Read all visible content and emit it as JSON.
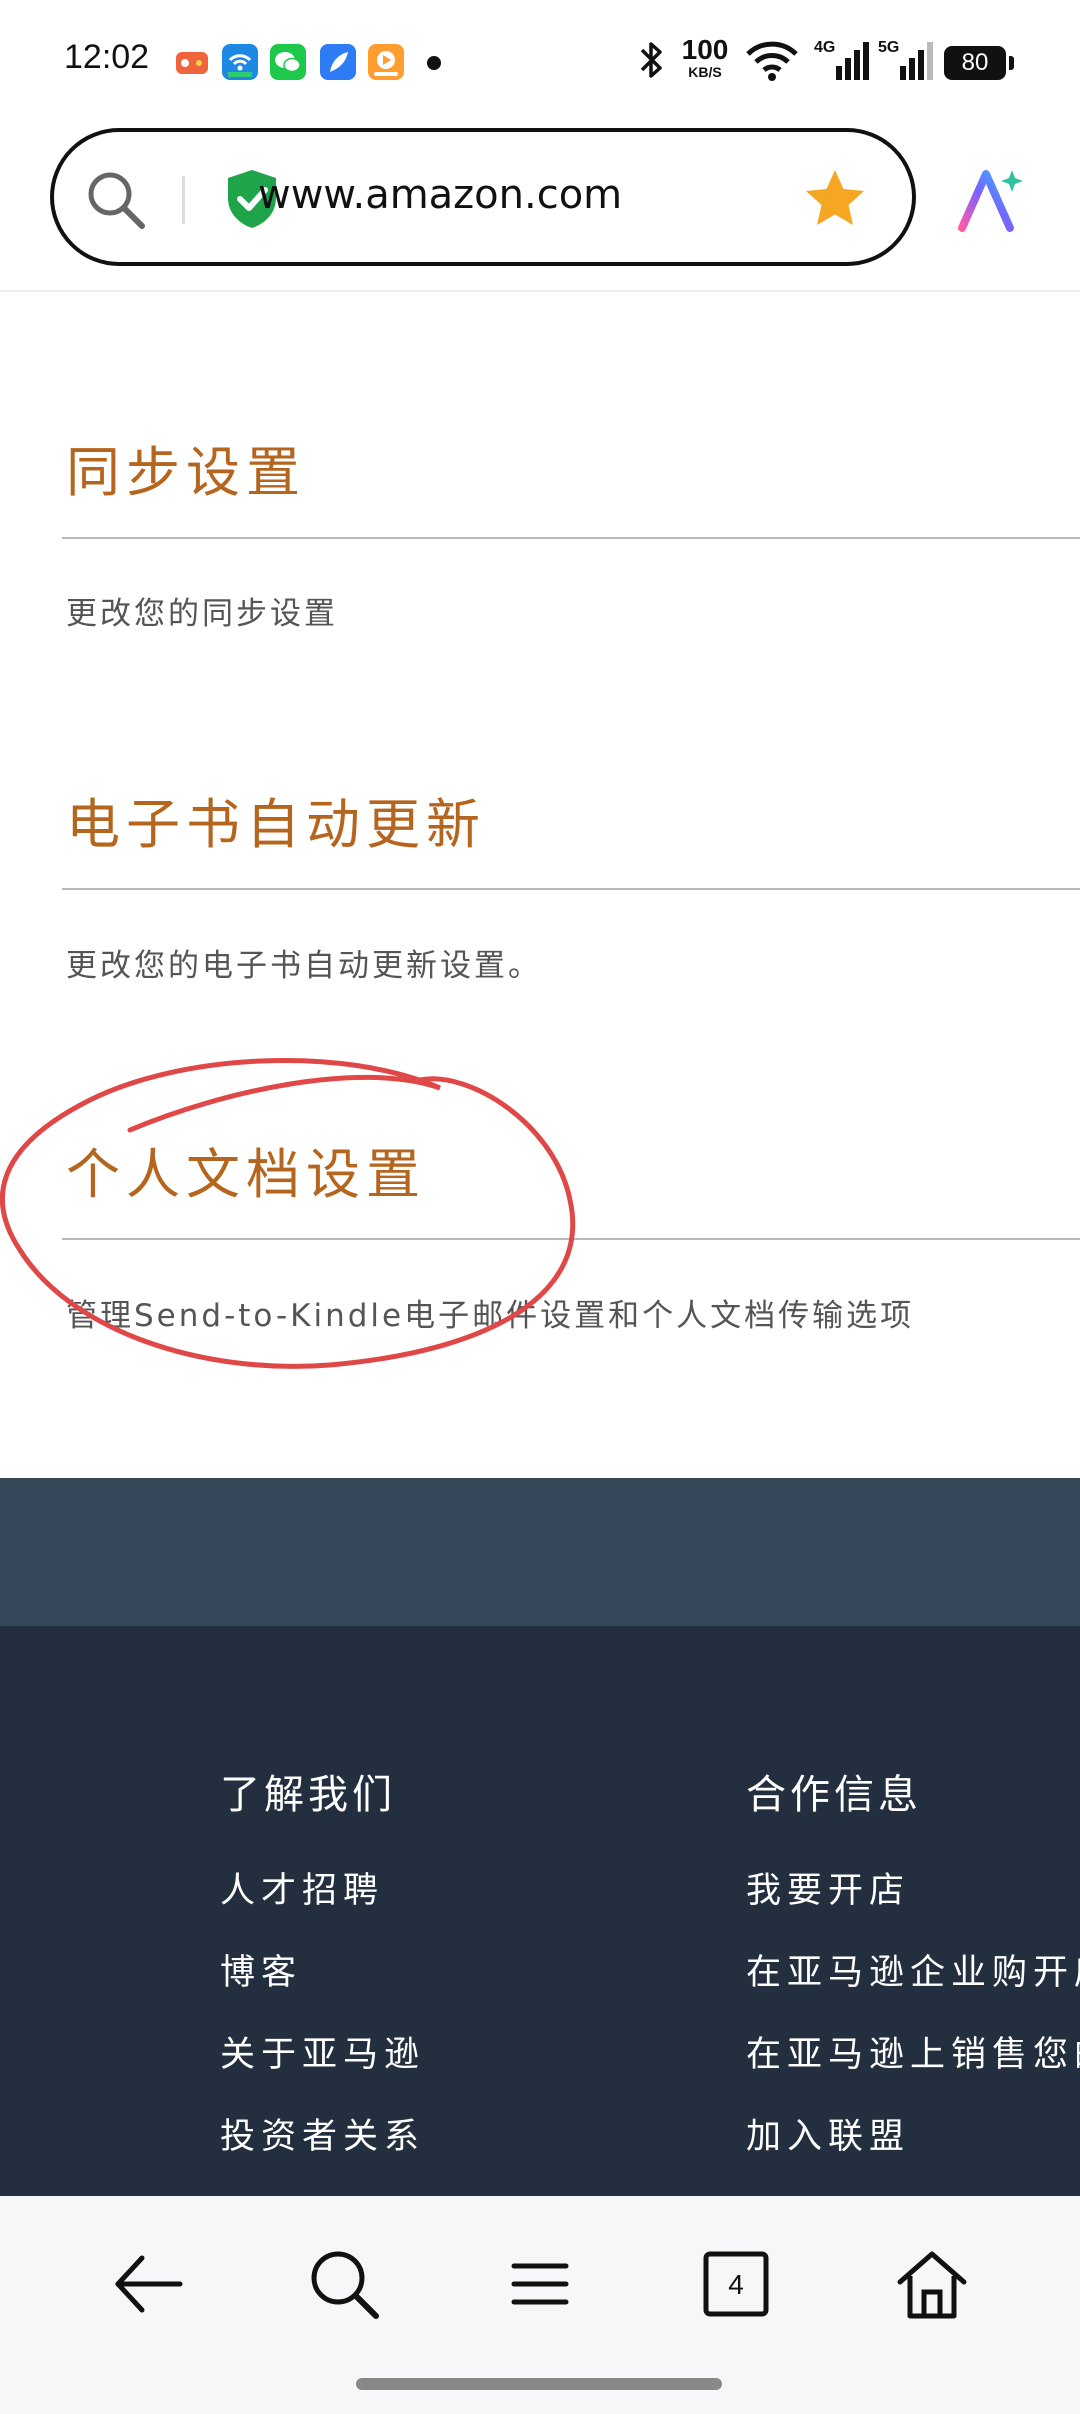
{
  "status_bar": {
    "time": "12:02",
    "net_speed_value": "100",
    "net_speed_unit": "KB/S",
    "network_4g": "4G",
    "network_5g": "5G",
    "battery": "80",
    "app_icons": [
      "game-app-icon",
      "wifi-app-icon",
      "wechat-icon",
      "feather-app-icon",
      "video-app-icon"
    ]
  },
  "browser": {
    "url": "www.amazon.com",
    "icons": [
      "search-icon",
      "shield-check-icon",
      "star-icon",
      "ai-assistant-icon"
    ]
  },
  "sections": [
    {
      "title": "同步设置",
      "description": "更改您的同步设置"
    },
    {
      "title": "电子书自动更新",
      "description": "更改您的电子书自动更新设置。"
    },
    {
      "title": "个人文档设置",
      "description": "管理Send-to-Kindle电子邮件设置和个人文档传输选项"
    }
  ],
  "annotation": {
    "color": "#e04848",
    "shape": "hand-drawn-circle"
  },
  "footer": {
    "col1": {
      "heading": "了解我们",
      "items": [
        "人才招聘",
        "博客",
        "关于亚马逊",
        "投资者关系"
      ]
    },
    "col2": {
      "heading": "合作信息",
      "items": [
        "我要开店",
        "在亚马逊企业购开店",
        "在亚马逊上销售您的",
        "加入联盟"
      ]
    }
  },
  "bottom_nav": {
    "tab_count": "4",
    "icons": [
      "back-icon",
      "search-icon",
      "menu-icon",
      "tabs-icon",
      "home-icon"
    ]
  },
  "colors": {
    "section_title": "#b5651d",
    "footer_bg": "#232f3e",
    "footer_top": "#37475a"
  }
}
